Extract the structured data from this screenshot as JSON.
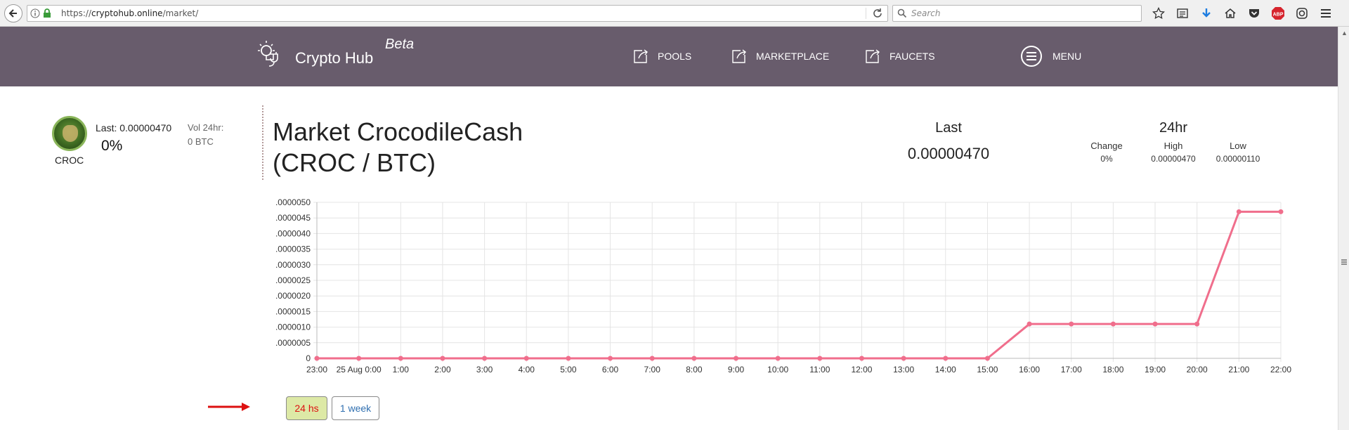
{
  "browser": {
    "url_prefix": "https://",
    "url_domain": "cryptohub.online",
    "url_path": "/market/",
    "search_placeholder": "Search",
    "toolbar_icons": [
      "star-icon",
      "reading-list-icon",
      "download-icon",
      "home-icon",
      "pocket-icon",
      "adblock-icon",
      "sync-icon",
      "hamburger-menu-icon"
    ],
    "adblock_label": "ABP"
  },
  "nav": {
    "brand": "Crypto Hub",
    "beta": "Beta",
    "items": [
      {
        "label": "POOLS",
        "icon": "external-link-icon"
      },
      {
        "label": "MARKETPLACE",
        "icon": "external-link-icon"
      },
      {
        "label": "FAUCETS",
        "icon": "external-link-icon"
      }
    ],
    "menu_label": "MENU",
    "bg_color": "#685c6c"
  },
  "coin": {
    "symbol": "CROC",
    "last_label": "Last:",
    "last_value": "0.00000470",
    "change_pct": "0%",
    "vol_label": "Vol 24hr:",
    "vol_value": "0 BTC"
  },
  "market": {
    "title_line1": "Market CrocodileCash",
    "title_line2": "(CROC / BTC)",
    "last_heading": "Last",
    "last_value": "0.00000470",
    "period_heading": "24hr",
    "stats": [
      {
        "label": "Change",
        "value": "0%"
      },
      {
        "label": "High",
        "value": "0.00000470"
      },
      {
        "label": "Low",
        "value": "0.00000110"
      }
    ]
  },
  "chart_data": {
    "type": "line",
    "title": "",
    "xlabel": "",
    "ylabel": "",
    "x": [
      "23:00",
      "25 Aug 0:00",
      "1:00",
      "2:00",
      "3:00",
      "4:00",
      "5:00",
      "6:00",
      "7:00",
      "8:00",
      "9:00",
      "10:00",
      "11:00",
      "12:00",
      "13:00",
      "14:00",
      "15:00",
      "16:00",
      "17:00",
      "18:00",
      "19:00",
      "20:00",
      "21:00",
      "22:00"
    ],
    "series": [
      {
        "values": [
          0,
          0,
          0,
          0,
          0,
          0,
          0,
          0,
          0,
          0,
          0,
          0,
          0,
          0,
          0,
          0,
          0,
          1.1e-06,
          1.1e-06,
          1.1e-06,
          1.1e-06,
          1.1e-06,
          4.7e-06,
          4.7e-06
        ]
      }
    ],
    "y_ticks": [
      "0",
      ".0000005",
      ".0000010",
      ".0000015",
      ".0000020",
      ".0000025",
      ".0000030",
      ".0000035",
      ".0000040",
      ".0000045",
      ".0000050"
    ],
    "ylim": [
      0,
      5e-06
    ],
    "grid": true,
    "line_color": "#f06e8c"
  },
  "range_buttons": {
    "day": "24 hs",
    "week": "1 week"
  }
}
